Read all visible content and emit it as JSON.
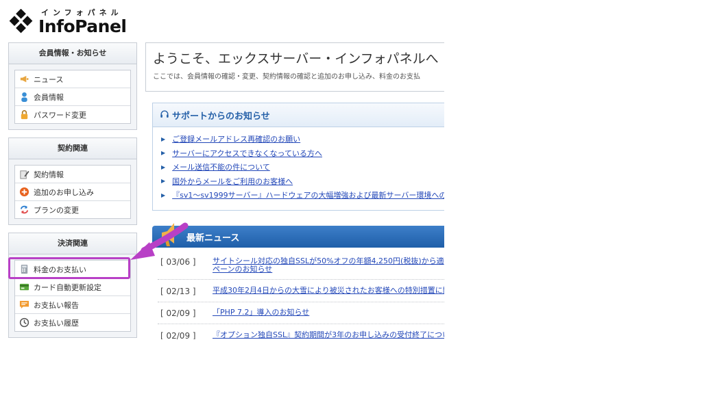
{
  "logo": {
    "kana": "インフォパネル",
    "name": "InfoPanel"
  },
  "sidebar": {
    "groups": [
      {
        "title": "会員情報・お知らせ",
        "items": [
          {
            "label": "ニュース",
            "icon": "megaphone-icon"
          },
          {
            "label": "会員情報",
            "icon": "user-icon"
          },
          {
            "label": "パスワード変更",
            "icon": "lock-icon"
          }
        ]
      },
      {
        "title": "契約関連",
        "items": [
          {
            "label": "契約情報",
            "icon": "document-pen-icon"
          },
          {
            "label": "追加のお申し込み",
            "icon": "plus-circle-icon"
          },
          {
            "label": "プランの変更",
            "icon": "refresh-icon"
          }
        ]
      },
      {
        "title": "決済関連",
        "items": [
          {
            "label": "料金のお支払い",
            "icon": "calculator-icon"
          },
          {
            "label": "カード自動更新設定",
            "icon": "credit-card-icon"
          },
          {
            "label": "お支払い報告",
            "icon": "chat-bubble-icon"
          },
          {
            "label": "お支払い履歴",
            "icon": "clock-icon"
          }
        ]
      }
    ]
  },
  "welcome": {
    "title": "ようこそ、エックスサーバー・インフォパネルへ",
    "subtitle": "ここでは、会員情報の確認・変更、契約情報の確認と追加のお申し込み、料金のお支払"
  },
  "support": {
    "title": "サポートからのお知らせ",
    "links": [
      "ご登録メールアドレス再確認のお願い",
      "サーバーにアクセスできなくなっている方へ",
      "メール送信不能の件について",
      "国外からメールをご利用のお客様へ",
      "『sv1～sv1999サーバー』ハードウェアの大幅増強および最新サーバー環境への"
    ]
  },
  "news": {
    "title": "最新ニュース",
    "items": [
      {
        "date": "[ 03/06 ]",
        "line1": "サイトシール対応の独自SSLが50%オフの年額4,250円(税抜)から適",
        "line2": "ペーンのお知らせ"
      },
      {
        "date": "[ 02/13 ]",
        "line1": "平成30年2月4日からの大雪により被災されたお客様への特別措置に関",
        "line2": ""
      },
      {
        "date": "[ 02/09 ]",
        "line1": "「PHP 7.2」導入のお知らせ",
        "line2": ""
      },
      {
        "date": "[ 02/09 ]",
        "line1": "『オプション独自SSL』契約期間が3年のお申し込みの受付終了につい",
        "line2": ""
      }
    ]
  },
  "colors": {
    "accent": "#2560a8",
    "link": "#2247b8",
    "highlight": "#b840c6"
  }
}
